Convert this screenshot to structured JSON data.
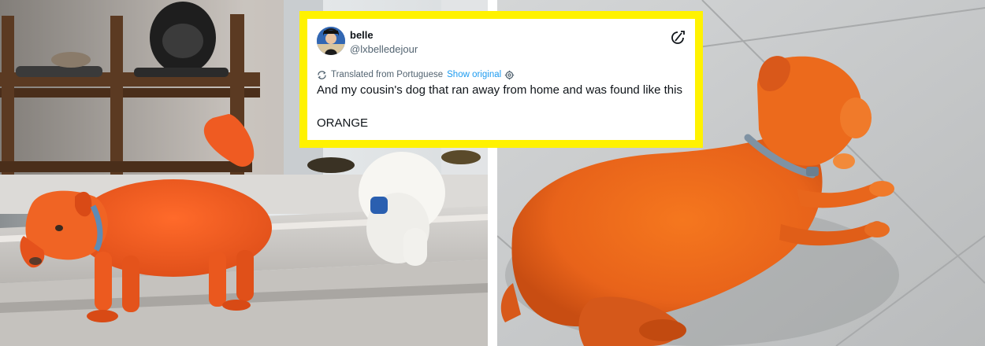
{
  "tweet": {
    "display_name": "belle",
    "handle": "@lxbelledejour",
    "translated_label": "Translated from Portuguese",
    "show_original_label": "Show original",
    "text_line_1": "And my cousin's dog that ran away from home and was found like this",
    "text_line_2": "ORANGE"
  },
  "colors": {
    "highlight_frame": "#fff200",
    "link_blue": "#1d9bf0",
    "dog_orange": "#f0651e"
  },
  "icons": {
    "brand": "x-logo-icon",
    "translate": "translate-icon",
    "settings": "gear-icon"
  }
}
